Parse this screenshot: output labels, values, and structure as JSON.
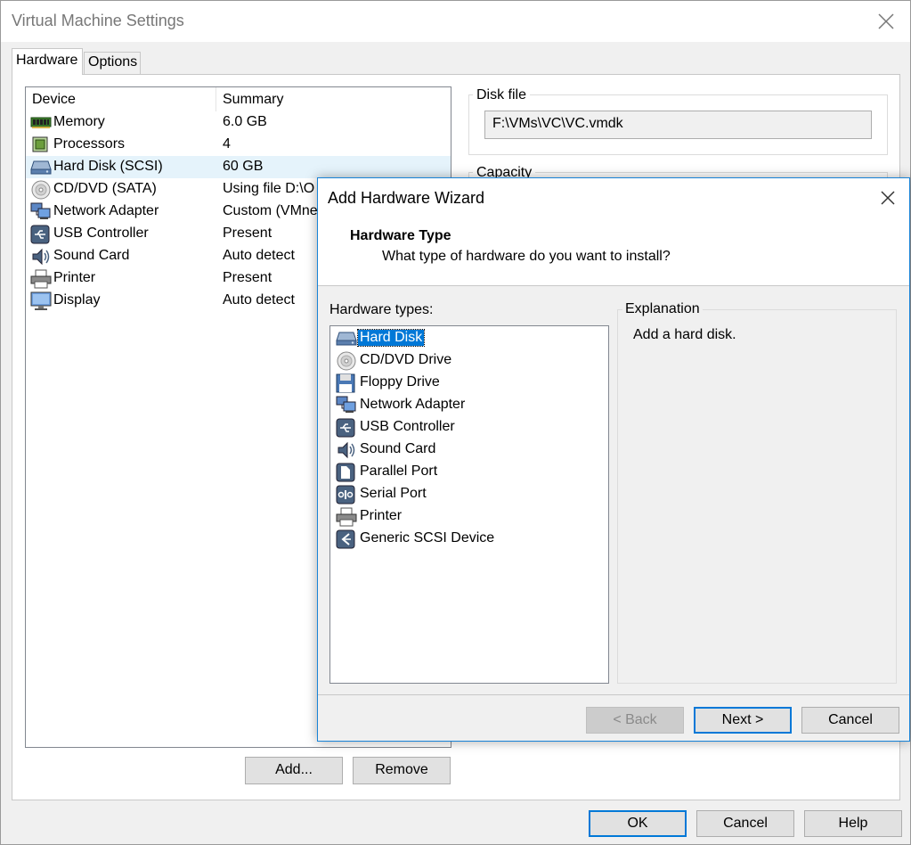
{
  "window": {
    "title": "Virtual Machine Settings",
    "close_icon": "close-icon"
  },
  "tabs": [
    {
      "label": "Hardware",
      "active": true
    },
    {
      "label": "Options",
      "active": false
    }
  ],
  "device_list": {
    "columns": [
      "Device",
      "Summary"
    ],
    "rows": [
      {
        "name": "Memory",
        "summary": "6.0 GB",
        "icon": "memory-icon"
      },
      {
        "name": "Processors",
        "summary": "4",
        "icon": "processor-icon"
      },
      {
        "name": "Hard Disk (SCSI)",
        "summary": "60 GB",
        "icon": "hard-disk-icon",
        "selected": true
      },
      {
        "name": "CD/DVD (SATA)",
        "summary": "Using file D:\\O",
        "icon": "cd-dvd-icon"
      },
      {
        "name": "Network Adapter",
        "summary": "Custom (VMnet",
        "icon": "network-adapter-icon"
      },
      {
        "name": "USB Controller",
        "summary": "Present",
        "icon": "usb-icon"
      },
      {
        "name": "Sound Card",
        "summary": "Auto detect",
        "icon": "sound-card-icon"
      },
      {
        "name": "Printer",
        "summary": "Present",
        "icon": "printer-icon"
      },
      {
        "name": "Display",
        "summary": "Auto detect",
        "icon": "display-icon"
      }
    ]
  },
  "disk_file": {
    "label": "Disk file",
    "value": "F:\\VMs\\VC\\VC.vmdk"
  },
  "capacity": {
    "label": "Capacity"
  },
  "buttons": {
    "add": "Add...",
    "remove": "Remove",
    "ok": "OK",
    "cancel": "Cancel",
    "help": "Help"
  },
  "wizard": {
    "title": "Add Hardware Wizard",
    "heading": "Hardware Type",
    "subheading": "What type of hardware do you want to install?",
    "types_label": "Hardware types:",
    "types": [
      {
        "label": "Hard Disk",
        "icon": "hard-disk-icon",
        "selected": true
      },
      {
        "label": "CD/DVD Drive",
        "icon": "cd-dvd-icon"
      },
      {
        "label": "Floppy Drive",
        "icon": "floppy-icon"
      },
      {
        "label": "Network Adapter",
        "icon": "network-adapter-icon"
      },
      {
        "label": "USB Controller",
        "icon": "usb-icon"
      },
      {
        "label": "Sound Card",
        "icon": "sound-card-icon"
      },
      {
        "label": "Parallel Port",
        "icon": "parallel-port-icon"
      },
      {
        "label": "Serial Port",
        "icon": "serial-port-icon"
      },
      {
        "label": "Printer",
        "icon": "printer-icon"
      },
      {
        "label": "Generic SCSI Device",
        "icon": "scsi-icon"
      }
    ],
    "explanation_label": "Explanation",
    "explanation_text": "Add a hard disk.",
    "back": "< Back",
    "next": "Next >",
    "cancel": "Cancel"
  },
  "colors": {
    "accent": "#0078d7",
    "selection_light": "#e5f3fb"
  }
}
